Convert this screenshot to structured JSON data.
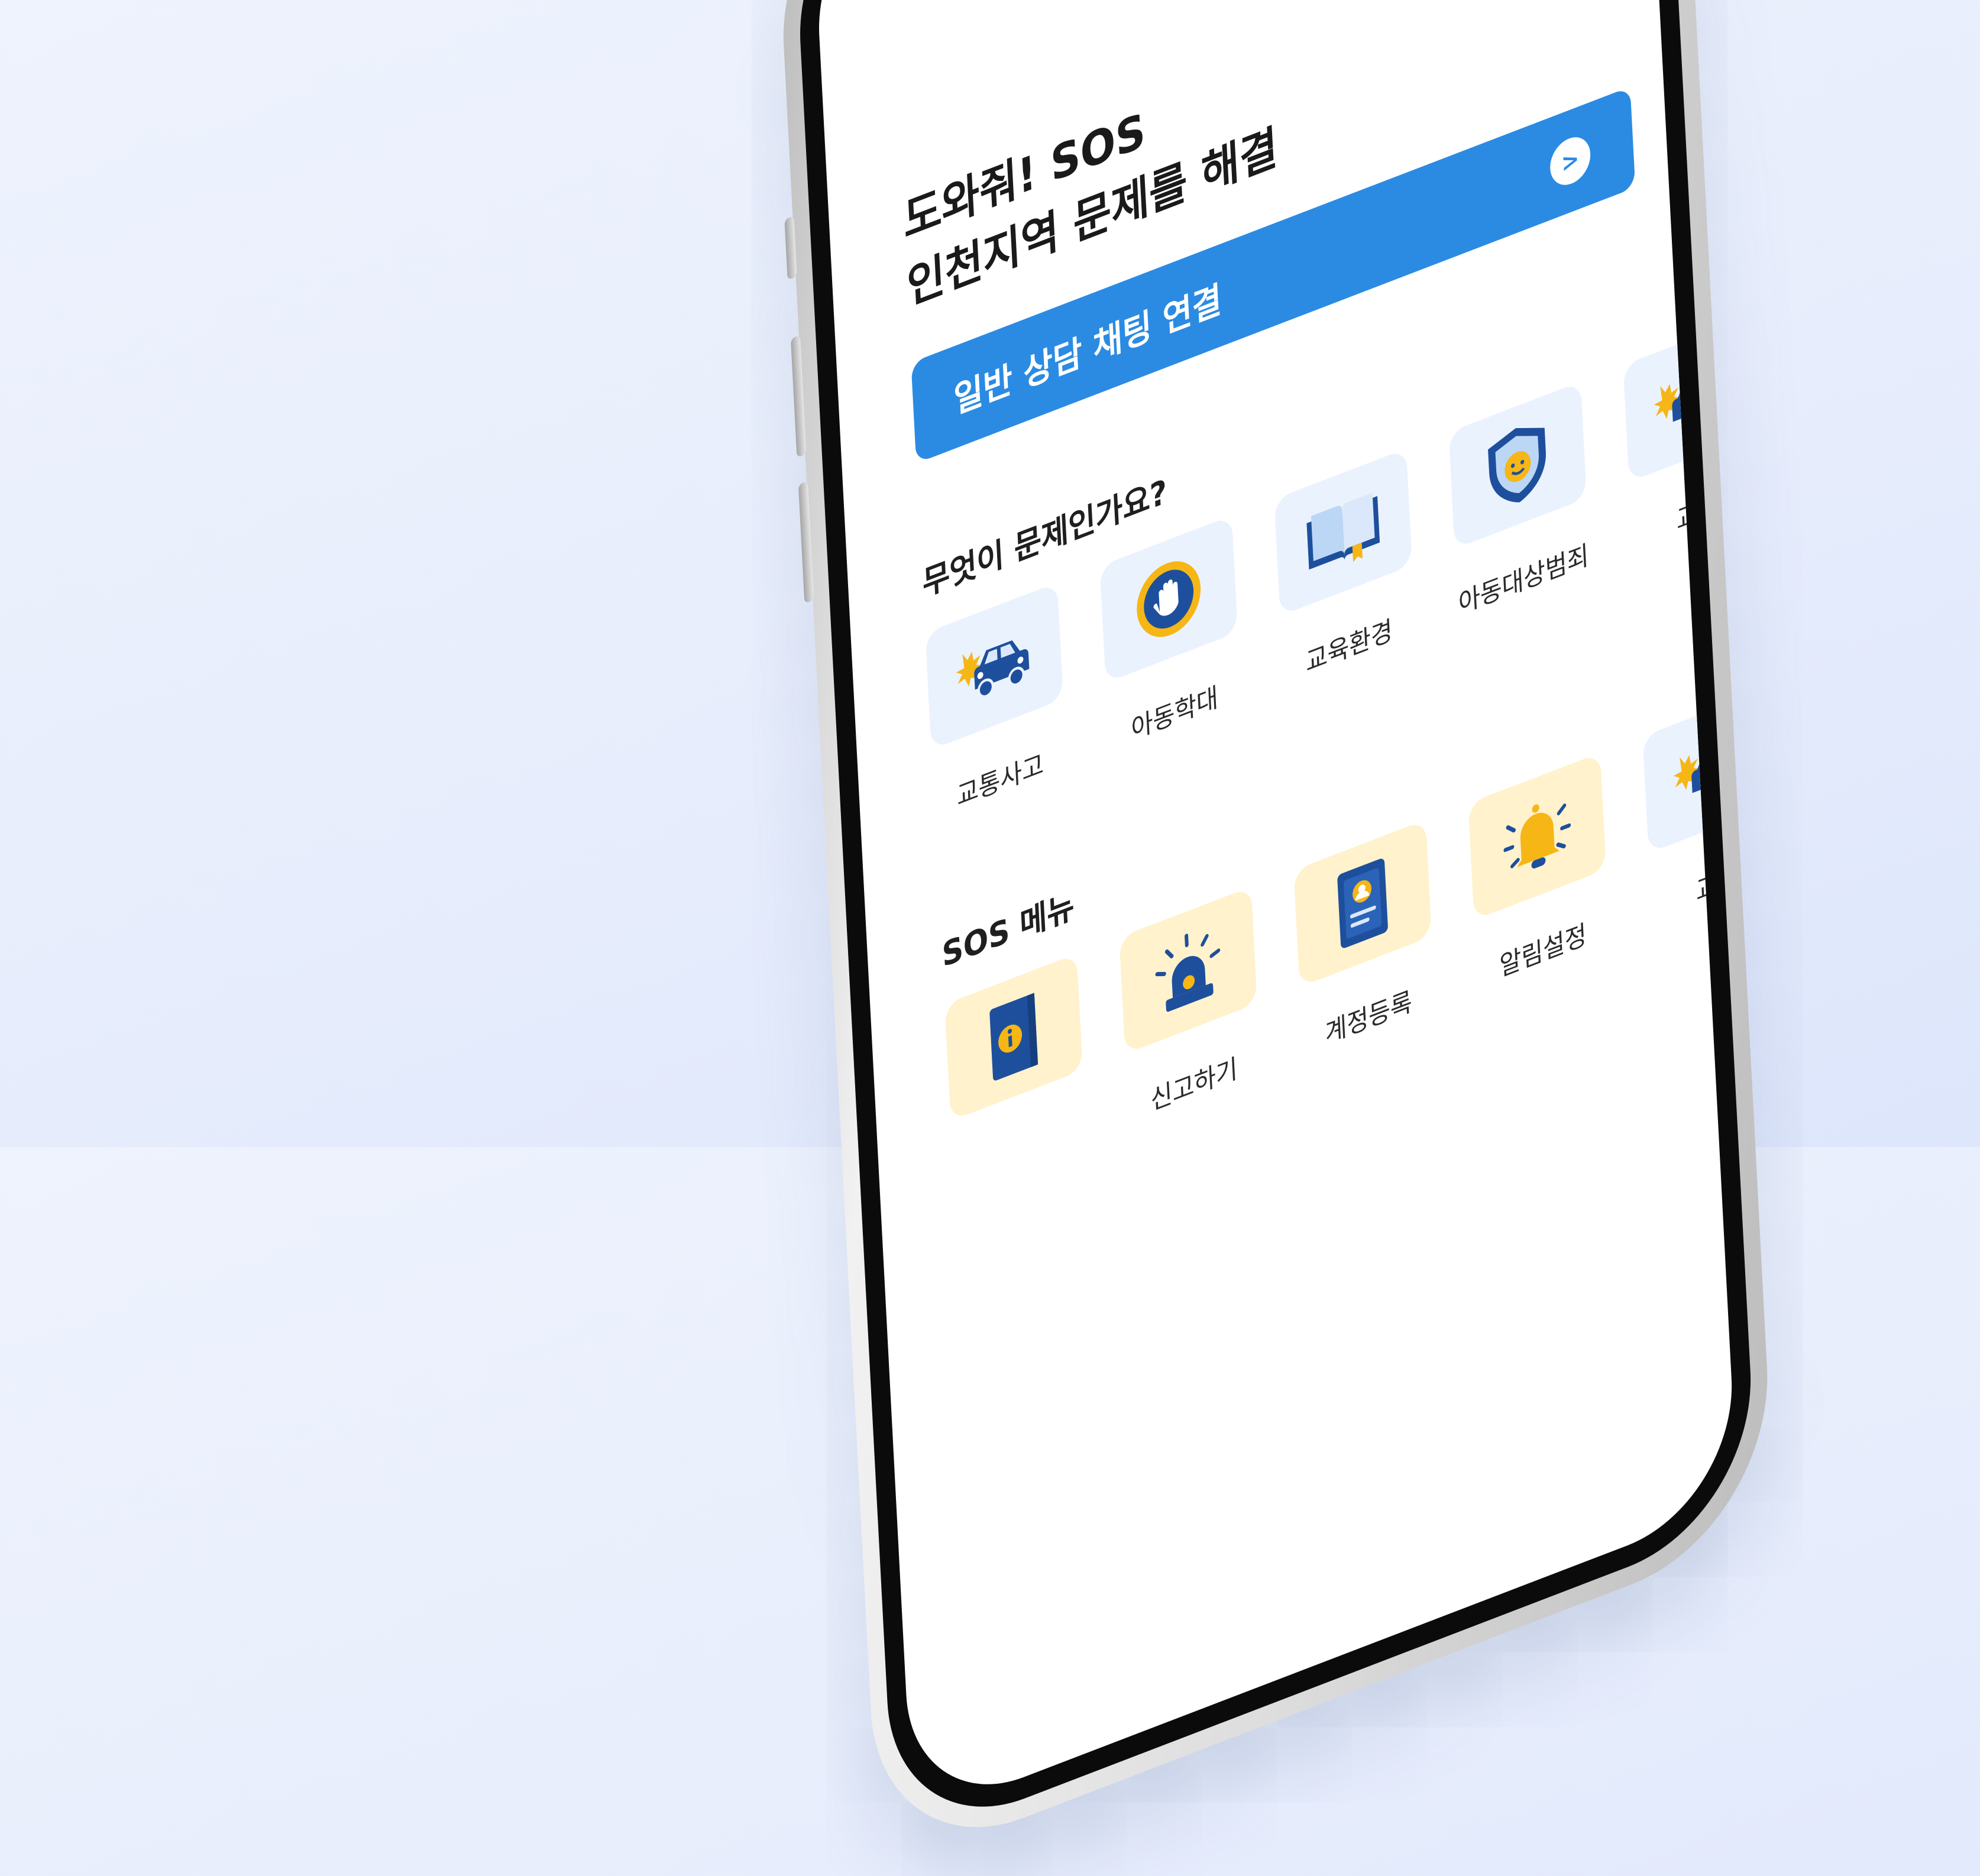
{
  "hero": {
    "line1": "도와줘! SOS",
    "line2": "인천지역 문제를 해결"
  },
  "chat_button": {
    "label": "일반 상담 채팅 연결",
    "arrow": ">"
  },
  "problems": {
    "title": "무엇이 문제인가요?",
    "items": [
      {
        "label": "교통사고",
        "icon": "car-crash-icon"
      },
      {
        "label": "아동학대",
        "icon": "stop-hand-icon"
      },
      {
        "label": "교육환경",
        "icon": "open-book-icon"
      },
      {
        "label": "아동대상범죄",
        "icon": "child-shield-icon"
      },
      {
        "label": "교통",
        "icon": "car-crash-icon"
      }
    ]
  },
  "sos_menu": {
    "title": "SOS 메뉴",
    "items": [
      {
        "label": "",
        "icon": "info-book-icon"
      },
      {
        "label": "신고하기",
        "icon": "siren-icon"
      },
      {
        "label": "계정등록",
        "icon": "id-card-icon"
      },
      {
        "label": "알림설정",
        "icon": "bell-icon"
      },
      {
        "label": "교통",
        "icon": "car-crash-icon"
      }
    ]
  },
  "colors": {
    "primary": "#2b8be3",
    "navy": "#1d4f9c",
    "yellow": "#f6b616",
    "tile_blue": "#eaf2fd",
    "tile_yellow": "#fff2cc"
  }
}
